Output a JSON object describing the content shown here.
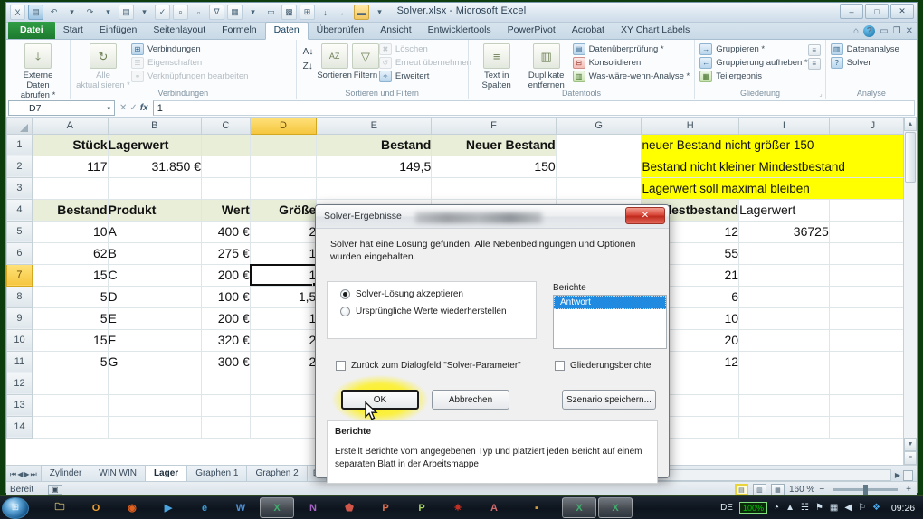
{
  "window": {
    "title": "Solver.xlsx - Microsoft Excel",
    "minimize": "–",
    "maximize": "□",
    "close": "✕"
  },
  "quick_access": [
    {
      "name": "excel-logo-icon",
      "glyph": "X"
    },
    {
      "name": "save-icon",
      "glyph": "■"
    },
    {
      "name": "undo-icon",
      "glyph": "↶"
    },
    {
      "name": "undo-dropdown-icon",
      "glyph": "▾"
    },
    {
      "name": "redo-icon",
      "glyph": "↷"
    },
    {
      "name": "redo-dropdown-icon",
      "glyph": "▾"
    },
    {
      "name": "print-preview-icon",
      "glyph": "▤"
    },
    {
      "name": "print-dropdown-icon",
      "glyph": "▾"
    },
    {
      "name": "spellcheck-icon",
      "glyph": "✓"
    },
    {
      "name": "research-icon",
      "glyph": "⌕"
    },
    {
      "name": "new-file-icon",
      "glyph": "□"
    },
    {
      "name": "filter-icon",
      "glyph": "∇"
    },
    {
      "name": "table-icon",
      "glyph": "⌸"
    },
    {
      "name": "table-dropdown-icon",
      "glyph": "▾"
    },
    {
      "name": "copy-icon",
      "glyph": "⎘"
    },
    {
      "name": "camera-icon",
      "glyph": "⌘"
    },
    {
      "name": "pivot-icon",
      "glyph": "⊞"
    },
    {
      "name": "sort-icon",
      "glyph": "↓"
    },
    {
      "name": "back-icon",
      "glyph": "←"
    },
    {
      "name": "open-folder-icon",
      "glyph": "▐"
    },
    {
      "name": "customize-qat-icon",
      "glyph": "▾"
    }
  ],
  "ribbon_tabs": [
    {
      "label": "Datei",
      "state": "file"
    },
    {
      "label": "Start",
      "state": "normal"
    },
    {
      "label": "Einfügen",
      "state": "normal"
    },
    {
      "label": "Seitenlayout",
      "state": "normal"
    },
    {
      "label": "Formeln",
      "state": "normal"
    },
    {
      "label": "Daten",
      "state": "active"
    },
    {
      "label": "Überprüfen",
      "state": "normal"
    },
    {
      "label": "Ansicht",
      "state": "normal"
    },
    {
      "label": "Entwicklertools",
      "state": "normal"
    },
    {
      "label": "PowerPivot",
      "state": "normal"
    },
    {
      "label": "Acrobat",
      "state": "normal"
    },
    {
      "label": "XY Chart Labels",
      "state": "normal"
    }
  ],
  "tab_right_icons": [
    {
      "name": "home-icon",
      "glyph": "⌂"
    },
    {
      "name": "help-icon",
      "glyph": "?"
    },
    {
      "name": "ribbon-minimize-icon",
      "glyph": "▁"
    },
    {
      "name": "restore-window-icon",
      "glyph": "❐"
    },
    {
      "name": "close-window-icon",
      "glyph": "✕"
    }
  ],
  "ribbon": {
    "groups": [
      {
        "label": "",
        "big_buttons": [
          {
            "name": "get-external-data-button",
            "label": "Externe Daten\nabrufen *",
            "icon": "database-icon",
            "glyph": "⤓",
            "dim": false
          }
        ]
      },
      {
        "label": "Verbindungen",
        "big_buttons": [
          {
            "name": "refresh-all-button",
            "label": "Alle\naktualisieren *",
            "icon": "refresh-icon",
            "glyph": "↻",
            "dim": true
          }
        ],
        "small_buttons": [
          {
            "name": "connections-button",
            "label": "Verbindungen",
            "icon": "connections-icon",
            "glyph": "⊞",
            "dim": false
          },
          {
            "name": "properties-button",
            "label": "Eigenschaften",
            "icon": "properties-icon",
            "glyph": "☰",
            "dim": true
          },
          {
            "name": "edit-links-button",
            "label": "Verknüpfungen bearbeiten",
            "icon": "link-icon",
            "glyph": "⚭",
            "dim": true
          }
        ]
      },
      {
        "label": "Sortieren und Filtern",
        "sort_buttons": [
          {
            "name": "sort-ascending-button",
            "label": "A↓",
            "glyph": "↓"
          },
          {
            "name": "sort-descending-button",
            "label": "Z↓",
            "glyph": "↓"
          }
        ],
        "big_buttons": [
          {
            "name": "sort-button",
            "label": "Sortieren",
            "icon": "sort-az-icon",
            "glyph": "AZ",
            "dim": false
          },
          {
            "name": "filter-button",
            "label": "Filtern",
            "icon": "funnel-icon",
            "glyph": "▽",
            "dim": false
          }
        ],
        "small_buttons": [
          {
            "name": "clear-filter-button",
            "label": "Löschen",
            "icon": "clear-icon",
            "glyph": "✖",
            "dim": true
          },
          {
            "name": "reapply-button",
            "label": "Erneut übernehmen",
            "icon": "reapply-icon",
            "glyph": "↺",
            "dim": true
          },
          {
            "name": "advanced-filter-button",
            "label": "Erweitert",
            "icon": "advanced-icon",
            "glyph": "✇",
            "dim": false
          }
        ]
      },
      {
        "label": "Datentools",
        "big_buttons": [
          {
            "name": "text-to-columns-button",
            "label": "Text in\nSpalten",
            "icon": "text-to-columns-icon",
            "glyph": "≡",
            "dim": false
          },
          {
            "name": "remove-duplicates-button",
            "label": "Duplikate\nentfernen",
            "icon": "remove-duplicates-icon",
            "glyph": "☷",
            "dim": false
          }
        ],
        "small_buttons": [
          {
            "name": "data-validation-button",
            "label": "Datenüberprüfung *",
            "icon": "validation-icon",
            "glyph": "✓",
            "dim": false
          },
          {
            "name": "consolidate-button",
            "label": "Konsolidieren",
            "icon": "consolidate-icon",
            "glyph": "⊟",
            "dim": false
          },
          {
            "name": "what-if-analysis-button",
            "label": "Was-wäre-wenn-Analyse *",
            "icon": "whatif-icon",
            "glyph": "☷",
            "dim": false
          }
        ]
      },
      {
        "label": "Gliederung",
        "small_buttons": [
          {
            "name": "group-button",
            "label": "Gruppieren *",
            "icon": "group-icon",
            "glyph": "→",
            "dim": false
          },
          {
            "name": "ungroup-button",
            "label": "Gruppierung aufheben *",
            "icon": "ungroup-icon",
            "glyph": "←",
            "dim": false
          },
          {
            "name": "subtotal-button",
            "label": "Teilergebnis",
            "icon": "subtotal-icon",
            "glyph": "⌸",
            "dim": false
          }
        ],
        "outline_icons": [
          {
            "name": "show-detail-icon",
            "glyph": "≡"
          },
          {
            "name": "hide-detail-icon",
            "glyph": "≡"
          }
        ]
      },
      {
        "label": "Analyse",
        "small_buttons": [
          {
            "name": "data-analysis-button",
            "label": "Datenanalyse",
            "icon": "data-analysis-icon",
            "glyph": "☷",
            "dim": false
          },
          {
            "name": "solver-button",
            "label": "Solver",
            "icon": "solver-icon",
            "glyph": "?",
            "dim": false
          }
        ]
      }
    ]
  },
  "formula_bar": {
    "name_box": "D7",
    "formula": "1",
    "cancel_icon": "✕",
    "accept_icon": "✓",
    "fx_label": "fx"
  },
  "grid": {
    "columns": [
      "A",
      "B",
      "C",
      "D",
      "E",
      "F",
      "G",
      "H",
      "I",
      "J"
    ],
    "selected_column": "D",
    "selected_row": "7",
    "rows": [
      "1",
      "2",
      "3",
      "4",
      "5",
      "6",
      "7",
      "8",
      "9",
      "10",
      "11",
      "12",
      "13",
      "14"
    ],
    "cells": {
      "row1": {
        "A": "Stück",
        "B": "Lagerwert",
        "C": "",
        "D": "",
        "E": "Bestand",
        "F": "Neuer Bestand",
        "G": "",
        "H": "neuer Bestand nicht größer 150"
      },
      "row2": {
        "A": "117",
        "B": "31.850 €",
        "C": "",
        "D": "",
        "E": "149,5",
        "F": "150",
        "G": "",
        "H": "Bestand nicht kleiner Mindestbestand"
      },
      "row3": {
        "A": "",
        "B": "",
        "C": "",
        "D": "",
        "E": "",
        "F": "",
        "G": "",
        "H": "Lagerwert soll maximal bleiben"
      },
      "row4": {
        "A": "Bestand",
        "B": "Produkt",
        "C": "Wert",
        "D": "Größe",
        "E": "",
        "F": "",
        "G": "",
        "H": "Mindestbestand",
        "I": "Lagerwert"
      },
      "row5": {
        "A": "10",
        "B": "A",
        "C": "400 €",
        "D": "2",
        "H": "12",
        "I": "36725"
      },
      "row6": {
        "A": "62",
        "B": "B",
        "C": "275 €",
        "D": "1",
        "H": "55",
        "I": ""
      },
      "row7": {
        "A": "15",
        "B": "C",
        "C": "200 €",
        "D": "1",
        "H": "21",
        "I": ""
      },
      "row8": {
        "A": "5",
        "B": "D",
        "C": "100 €",
        "D": "1,5",
        "H": "6",
        "I": ""
      },
      "row9": {
        "A": "5",
        "B": "E",
        "C": "200 €",
        "D": "1",
        "H": "10",
        "I": ""
      },
      "row10": {
        "A": "15",
        "B": "F",
        "C": "320 €",
        "D": "2",
        "H": "20",
        "I": ""
      },
      "row11": {
        "A": "5",
        "B": "G",
        "C": "300 €",
        "D": "2",
        "H": "12",
        "I": ""
      },
      "row12": {
        "A": "",
        "B": "",
        "C": "",
        "D": "",
        "H": "",
        "I": ""
      },
      "row13": {
        "A": "",
        "B": "",
        "C": "",
        "D": "",
        "H": "",
        "I": ""
      },
      "row14": {
        "A": "",
        "B": "",
        "C": "",
        "D": "",
        "H": "",
        "I": ""
      }
    },
    "note_color": "#ffff00",
    "header_fill": "#e8eed7"
  },
  "sheet_tabs": {
    "nav": [
      "⏮",
      "◀",
      "▶",
      "⏭"
    ],
    "tabs": [
      {
        "label": "Zylinder",
        "active": false
      },
      {
        "label": "WIN WIN",
        "active": false
      },
      {
        "label": "Lager",
        "active": true
      },
      {
        "label": "Graphen 1",
        "active": false
      },
      {
        "label": "Graphen 2",
        "active": false
      }
    ],
    "new_sheet_icon": "⊞"
  },
  "status_bar": {
    "state": "Bereit",
    "macro_icon": "▣",
    "view_buttons": [
      {
        "name": "normal-view-button",
        "glyph": "▤",
        "active": true
      },
      {
        "name": "page-layout-view-button",
        "glyph": "▥",
        "active": false
      },
      {
        "name": "page-break-view-button",
        "glyph": "▦",
        "active": false
      }
    ],
    "zoom_out": "−",
    "zoom_in": "+",
    "zoom_level": "160 %"
  },
  "dialog": {
    "title": "Solver-Ergebnisse",
    "close_icon": "✕",
    "message": "Solver hat eine Lösung gefunden. Alle Nebenbedingungen und Optionen wurden eingehalten.",
    "radio_options": [
      {
        "label": "Solver-Lösung akzeptieren",
        "selected": true
      },
      {
        "label": "Ursprüngliche Werte wiederherstellen",
        "selected": false
      }
    ],
    "reports_label": "Berichte",
    "reports_items": [
      {
        "label": "Antwort",
        "selected": true
      }
    ],
    "checkboxes": [
      {
        "label": "Zurück zum Dialogfeld \"Solver-Parameter\"",
        "checked": false
      },
      {
        "label": "Gliederungsberichte",
        "checked": false
      }
    ],
    "buttons": {
      "ok": "OK",
      "cancel": "Abbrechen",
      "save_scenario": "Szenario speichern..."
    },
    "info_title": "Berichte",
    "info_text": "Erstellt Berichte vom angegebenen Typ und platziert jeden Bericht auf einem separaten Blatt in der Arbeitsmappe"
  },
  "taskbar": {
    "start_glyph": "⊞",
    "items": [
      {
        "name": "taskbar-explorer",
        "glyph": "🗀",
        "color": "#d8c070",
        "active": false
      },
      {
        "name": "taskbar-office",
        "glyph": "O",
        "color": "#f0a030",
        "active": false
      },
      {
        "name": "taskbar-firefox",
        "glyph": "◉",
        "color": "#e06020",
        "active": false
      },
      {
        "name": "taskbar-media-player",
        "glyph": "▶",
        "color": "#4ba3dd",
        "active": false
      },
      {
        "name": "taskbar-internet-explorer",
        "glyph": "e",
        "color": "#3b9cd8",
        "active": false
      },
      {
        "name": "taskbar-word",
        "glyph": "W",
        "color": "#2b579a",
        "active": false
      },
      {
        "name": "taskbar-excel",
        "glyph": "X",
        "color": "#1f7244",
        "active": true
      },
      {
        "name": "taskbar-onenote",
        "glyph": "N",
        "color": "#7a2f8f",
        "active": false
      },
      {
        "name": "taskbar-acrobat",
        "glyph": "⬟",
        "color": "#c4291c",
        "active": false
      },
      {
        "name": "taskbar-powerpoint",
        "glyph": "P",
        "color": "#d04423",
        "active": false
      },
      {
        "name": "taskbar-publisher",
        "glyph": "P",
        "color": "#84b33a",
        "active": false
      },
      {
        "name": "taskbar-app-red",
        "glyph": "✷",
        "color": "#c03024",
        "active": false
      },
      {
        "name": "taskbar-access",
        "glyph": "A",
        "color": "#a4373a",
        "active": false
      },
      {
        "name": "taskbar-folder",
        "glyph": "■",
        "color": "#d2a040",
        "active": false
      },
      {
        "name": "taskbar-excel-window-1",
        "glyph": "X",
        "color": "#1f7244",
        "active": false
      },
      {
        "name": "taskbar-excel-window-2",
        "glyph": "X",
        "color": "#1f7244",
        "active": false
      }
    ],
    "language": "DE",
    "battery": "100%",
    "tray_icons": [
      {
        "name": "show-hidden-icons",
        "glyph": "▲"
      },
      {
        "name": "network-icon",
        "glyph": "☵"
      },
      {
        "name": "action-center-icon",
        "glyph": "⚑"
      },
      {
        "name": "signal-icon",
        "glyph": "▦"
      },
      {
        "name": "volume-icon",
        "glyph": "◀"
      },
      {
        "name": "flag-icon",
        "glyph": "⚑"
      },
      {
        "name": "dropbox-icon",
        "glyph": "❖"
      }
    ],
    "clock": "09:26"
  }
}
